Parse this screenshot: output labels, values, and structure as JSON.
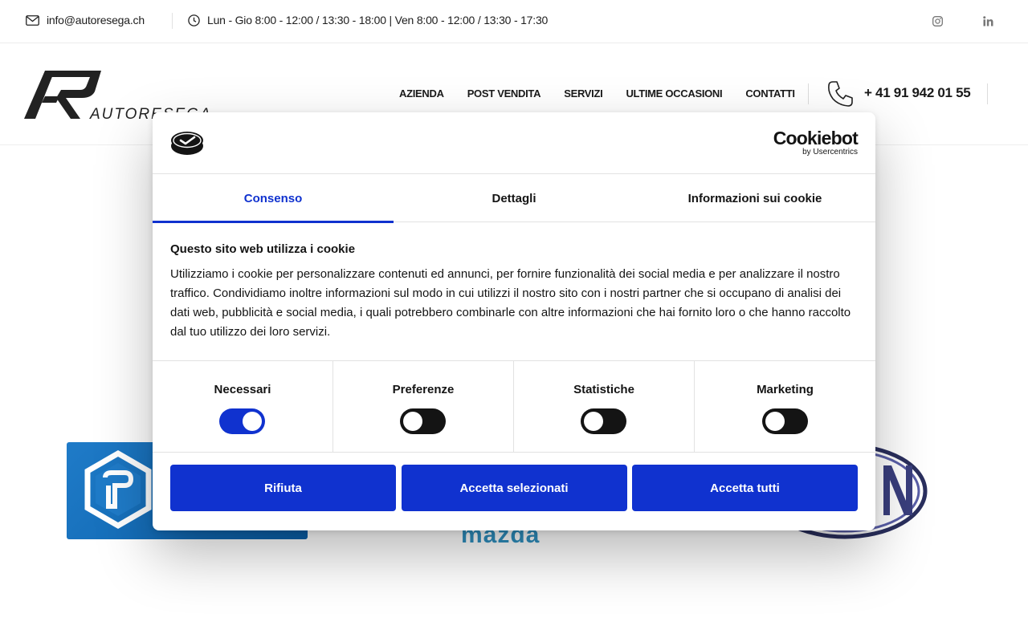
{
  "topbar": {
    "email": "info@autoresega.ch",
    "hours": "Lun - Gio 8:00 - 12:00 / 13:30 - 18:00 | Ven 8:00 - 12:00 / 13:30 - 17:30",
    "social": [
      "instagram-icon",
      "linkedin-icon"
    ]
  },
  "header": {
    "logo_text": "AUTORESEGA",
    "nav": [
      "AZIENDA",
      "POST VENDITA",
      "SERVIZI",
      "ULTIME OCCASIONI",
      "CONTATTI"
    ],
    "phone": "+ 41 91 942 01 55"
  },
  "brands": {
    "mazda": "mazda"
  },
  "cookie": {
    "brand_name": "Cookiebot",
    "brand_by": "by Usercentrics",
    "tabs": [
      "Consenso",
      "Dettagli",
      "Informazioni sui cookie"
    ],
    "active_tab": "Consenso",
    "title": "Questo sito web utilizza i cookie",
    "text": "Utilizziamo i cookie per personalizzare contenuti ed annunci, per fornire funzionalità dei social media e per analizzare il nostro traffico. Condividiamo inoltre informazioni sul modo in cui utilizzi il nostro sito con i nostri partner che si occupano di analisi dei dati web, pubblicità e social media, i quali potrebbero combinarle con altre informazioni che hai fornito loro o che hanno raccolto dal tuo utilizzo dei loro servizi.",
    "categories": [
      {
        "label": "Necessari",
        "enabled": true
      },
      {
        "label": "Preferenze",
        "enabled": false
      },
      {
        "label": "Statistiche",
        "enabled": false
      },
      {
        "label": "Marketing",
        "enabled": false
      }
    ],
    "buttons": {
      "reject": "Rifiuta",
      "accept_selected": "Accetta selezionati",
      "accept_all": "Accetta tutti"
    },
    "accent_color": "#1032cf"
  }
}
